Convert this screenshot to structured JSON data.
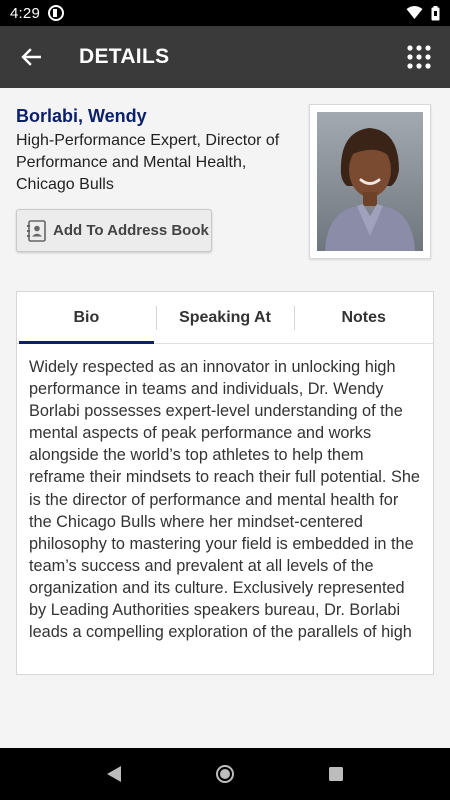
{
  "status_bar": {
    "time": "4:29"
  },
  "app_bar": {
    "title": "DETAILS"
  },
  "speaker": {
    "name": "Borlabi, Wendy",
    "role": "High-Performance Expert, Director of Performance and Mental Health, Chicago Bulls"
  },
  "actions": {
    "add_to_address_book": "Add To Address Book"
  },
  "tabs": [
    {
      "label": "Bio",
      "active": true
    },
    {
      "label": "Speaking At",
      "active": false
    },
    {
      "label": "Notes",
      "active": false
    }
  ],
  "bio": "Widely respected as an innovator in unlocking high performance in teams and individuals, Dr. Wendy Borlabi possesses expert-level understanding of the mental aspects of peak performance and works alongside the world’s top athletes to help them reframe their mindsets to reach their full potential. She is the director of performance and mental health for the Chicago Bulls where her mindset-centered philosophy to mastering your field is embedded in the team’s success and prevalent at all levels of the organization and its culture. Exclusively represented by Leading Authorities speakers bureau, Dr. Borlabi leads a compelling exploration of the parallels of high",
  "colors": {
    "accent": "#0b1f6b",
    "app_bar": "#3a3a3a"
  },
  "icons": {
    "back": "arrow-left-icon",
    "menu": "grid-menu-icon",
    "address_book": "contact-card-icon"
  }
}
